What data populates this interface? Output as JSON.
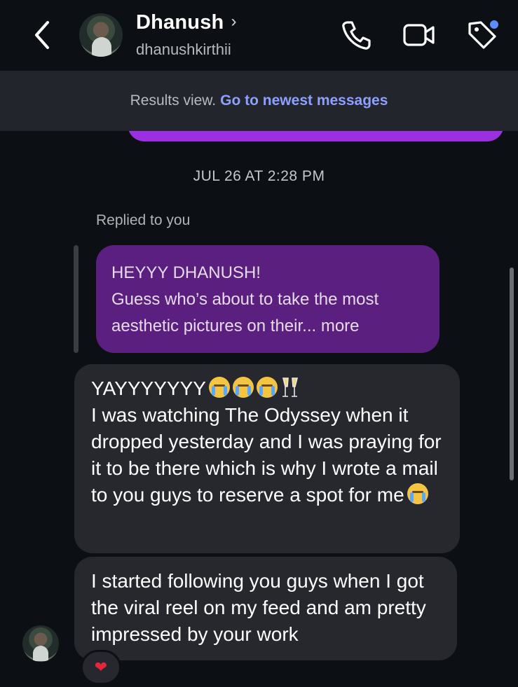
{
  "header": {
    "name": "Dhanush",
    "chevron": "›",
    "username": "dhanushkirthii",
    "icons": [
      "chevron-left-icon",
      "phone-icon",
      "video-camera-icon",
      "tag-icon"
    ],
    "notification_dot_color": "#5b8cff"
  },
  "banner": {
    "text": "Results view.",
    "link": "Go to newest messages"
  },
  "thread": {
    "timestamp": "JUL 26 AT 2:28 PM",
    "replied_label": "Replied to you",
    "replied_message": {
      "line1": "HEYYY DHANUSH!",
      "line2": "Guess who’s about to take the most",
      "line3": "aesthetic pictures on their... more"
    },
    "message1": {
      "first_line": "YAYYYYYYY",
      "text": "I was watching The Odyssey when it dropped yesterday and I was praying for it to be there which is why I wrote a mail to you guys to reserve a spot for me"
    },
    "message2": {
      "text": "I started following you guys when I got the viral reel on my feed and am pretty impressed by your work"
    },
    "reaction": "❤"
  },
  "colors": {
    "background": "#0c0f14",
    "incoming_bubble": "#26282e",
    "replied_bubble": "#5a1f7f",
    "outgoing_peek": "#9c2fe0",
    "link": "#8ea0ff"
  }
}
